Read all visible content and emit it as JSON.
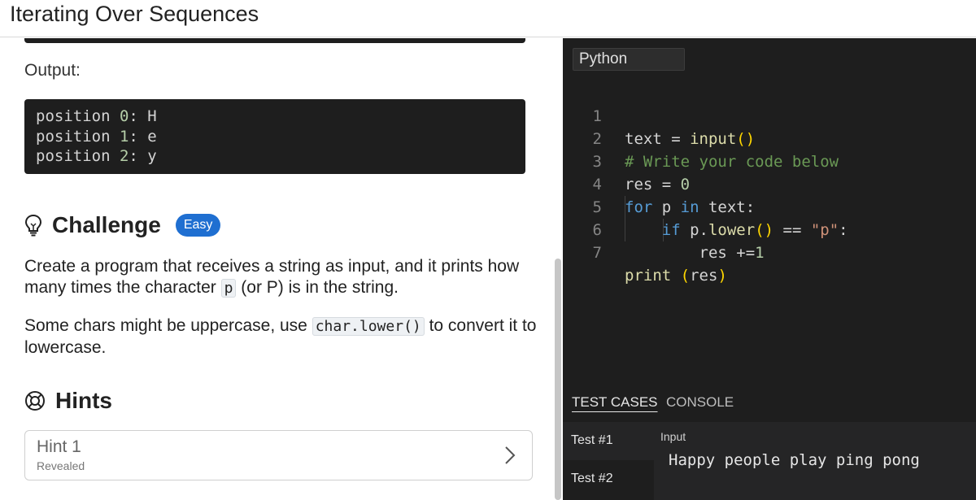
{
  "header": {
    "title": "Iterating Over Sequences"
  },
  "lesson": {
    "output_label": "Output:",
    "output_lines": [
      {
        "prefix": "position ",
        "num": "0",
        "suffix": ": H"
      },
      {
        "prefix": "position ",
        "num": "1",
        "suffix": ": e"
      },
      {
        "prefix": "position ",
        "num": "2",
        "suffix": ": y"
      }
    ],
    "challenge": {
      "heading": "Challenge",
      "badge": "Easy",
      "para1_a": "Create a program that receives a string as input, and it prints how many times the character ",
      "para1_code": "p",
      "para1_b": " (or P) is in the string.",
      "para2_a": "Some chars might be uppercase, use ",
      "para2_code": "char.lower()",
      "para2_b": " to convert it to lowercase."
    },
    "hints": {
      "heading": "Hints",
      "items": [
        {
          "title": "Hint 1",
          "status": "Revealed"
        }
      ]
    }
  },
  "editor": {
    "language": "Python",
    "line_numbers": [
      "1",
      "2",
      "3",
      "4",
      "5",
      "6",
      "7"
    ]
  },
  "bottom_panel": {
    "tabs": [
      "TEST CASES",
      "CONSOLE"
    ],
    "active_tab": "TEST CASES",
    "tests": [
      "Test #1",
      "Test #2"
    ],
    "input_label": "Input",
    "input_value": "Happy people play ping pong"
  },
  "colors": {
    "badge": "#1f6fd1",
    "editor_bg": "#1e1e1e",
    "keyword": "#569cd6",
    "comment": "#6a9955",
    "number": "#b5cea8",
    "string": "#ce9178"
  },
  "icons": {
    "challenge": "lightbulb-icon",
    "hints": "lifebuoy-icon",
    "hint_expand": "chevron-right-icon"
  }
}
